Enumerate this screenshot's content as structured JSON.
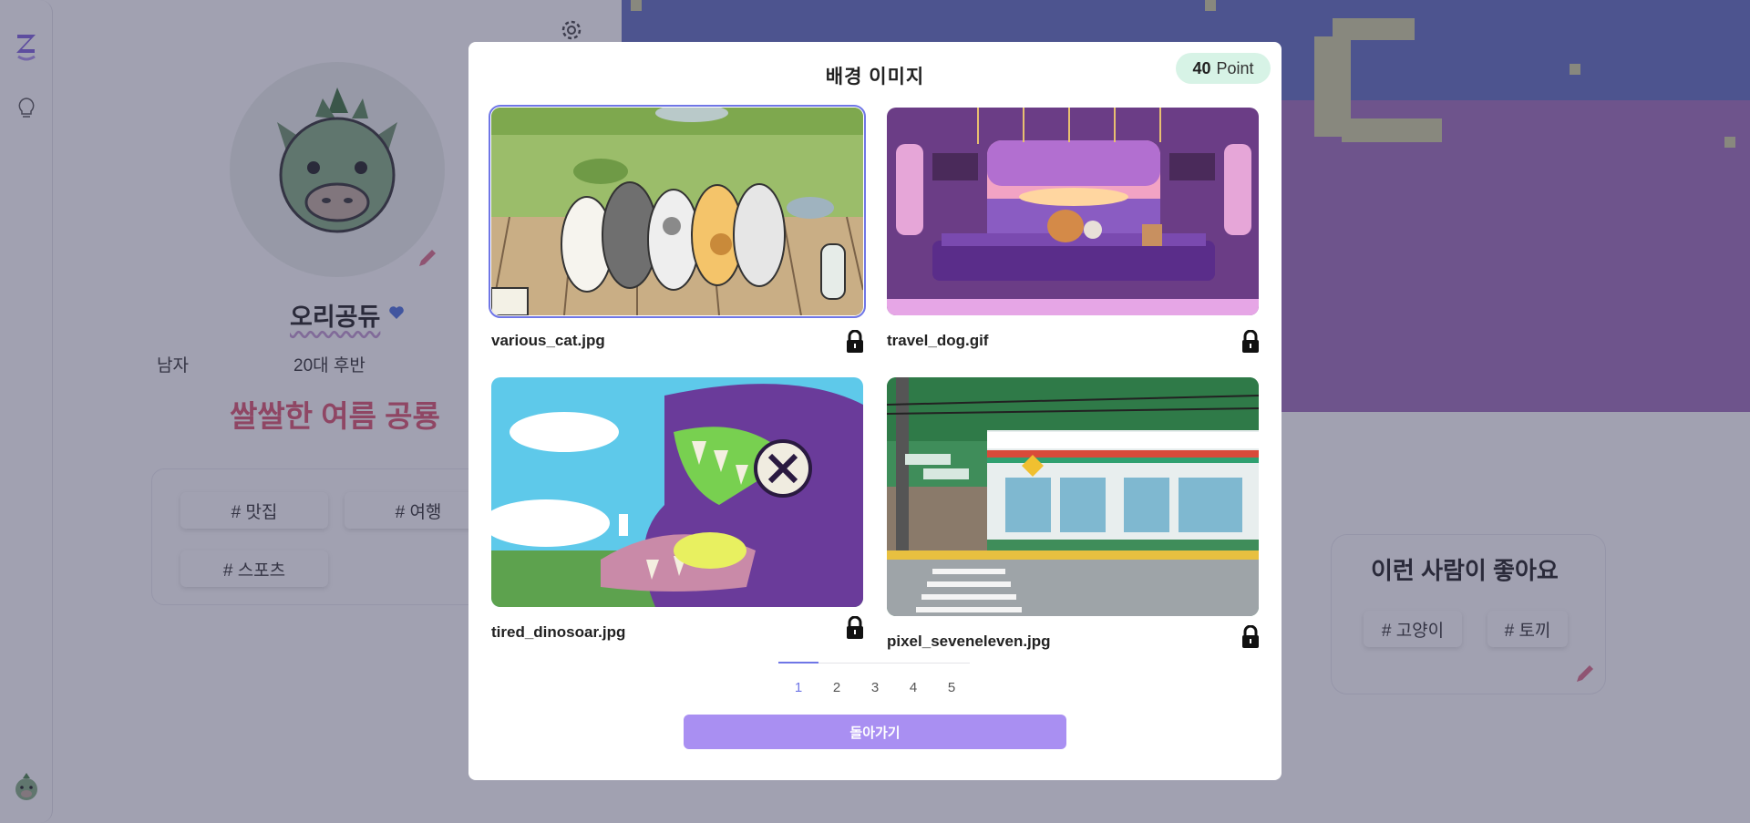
{
  "profile": {
    "nickname": "오리공듀",
    "gender": "남자",
    "age": "20대 후반",
    "status": "쌀쌀한 여름 공룡",
    "tags": [
      "# 맛집",
      "# 여행",
      "# 스포츠"
    ]
  },
  "likes": {
    "title": "이런 사람이 좋아요",
    "tags": [
      "# 고양이",
      "# 토끼"
    ]
  },
  "modal": {
    "title": "배경 이미지",
    "points": {
      "value": "40",
      "unit": "Point"
    },
    "images": [
      {
        "file": "various_cat.jpg",
        "selected": true,
        "locked": true
      },
      {
        "file": "travel_dog.gif",
        "selected": false,
        "locked": true
      },
      {
        "file": "tired_dinosoar.jpg",
        "selected": false,
        "locked": true
      },
      {
        "file": "pixel_seveneleven.jpg",
        "selected": false,
        "locked": true
      }
    ],
    "pagination": {
      "pages": [
        "1",
        "2",
        "3",
        "4",
        "5"
      ],
      "current": "1"
    },
    "back_label": "돌아가기"
  },
  "colors": {
    "accent": "#6f76e6",
    "button": "#a98ff2",
    "point_badge": "#d7f3e6",
    "status_text": "#e0627a"
  }
}
